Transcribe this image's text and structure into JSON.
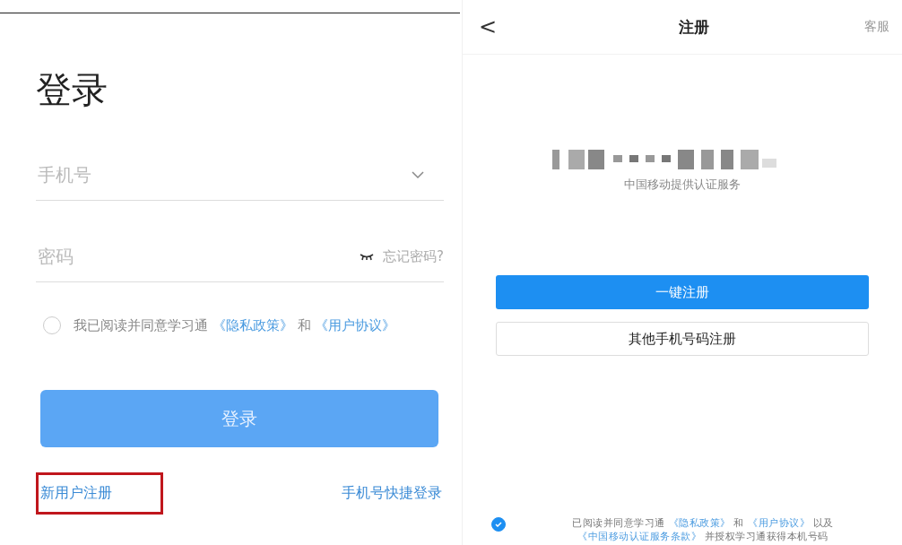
{
  "login": {
    "title": "登录",
    "phone_field": {
      "placeholder": "手机号"
    },
    "password_field": {
      "placeholder": "密码",
      "forgot": "忘记密码?"
    },
    "agreement": {
      "checked": false,
      "text": "我已阅读并同意学习通",
      "privacy": "《隐私政策》",
      "and": "和",
      "terms": "《用户协议》"
    },
    "login_button": "登录",
    "register_link": {
      "label": "新用户注册",
      "highlighted": true
    },
    "quick_login": "手机号快捷登录"
  },
  "register": {
    "back": "<",
    "title": "注册",
    "service": "客服",
    "provider_note": "中国移动提供认证服务",
    "one_click_button": "一键注册",
    "other_button": "其他手机号码注册",
    "agreement": {
      "checked": true,
      "parts": [
        {
          "kind": "plain",
          "text": "已阅读并同意学习通"
        },
        {
          "kind": "link",
          "text": "《隐私政策》"
        },
        {
          "kind": "plain",
          "text": "和"
        },
        {
          "kind": "link",
          "text": "《用户协议》"
        },
        {
          "kind": "plain",
          "text": "以及"
        },
        {
          "kind": "link",
          "text": "《中国移动认证服务条款》"
        },
        {
          "kind": "plain",
          "text": "并授权学习通获得本机号码"
        }
      ]
    }
  }
}
